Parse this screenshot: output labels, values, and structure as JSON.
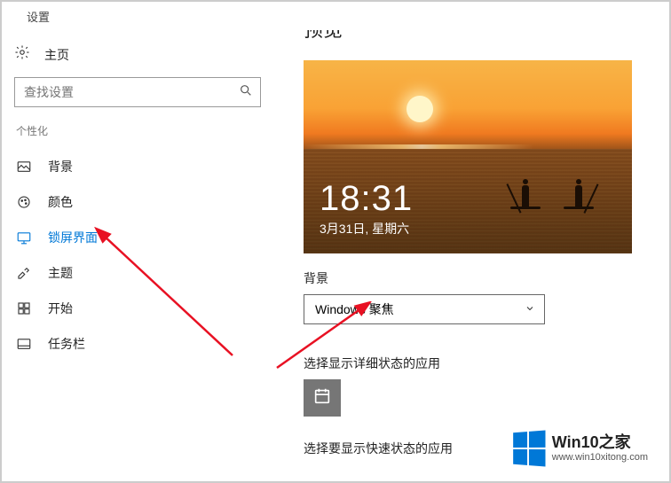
{
  "topbar": {
    "title": "设置"
  },
  "sidebar": {
    "home": "主页",
    "search_placeholder": "查找设置",
    "category": "个性化",
    "items": [
      {
        "label": "背景"
      },
      {
        "label": "颜色"
      },
      {
        "label": "锁屏界面",
        "active": true
      },
      {
        "label": "主题"
      },
      {
        "label": "开始"
      },
      {
        "label": "任务栏"
      }
    ]
  },
  "main": {
    "title": "预览",
    "clock_time": "18:31",
    "clock_date": "3月31日, 星期六",
    "bg_section_label": "背景",
    "bg_dropdown_value": "Windows 聚焦",
    "detail_apps_label": "选择显示详细状态的应用",
    "quick_apps_label": "选择要显示快速状态的应用"
  },
  "watermark": {
    "title": "Win10之家",
    "url": "www.win10xitong.com"
  }
}
